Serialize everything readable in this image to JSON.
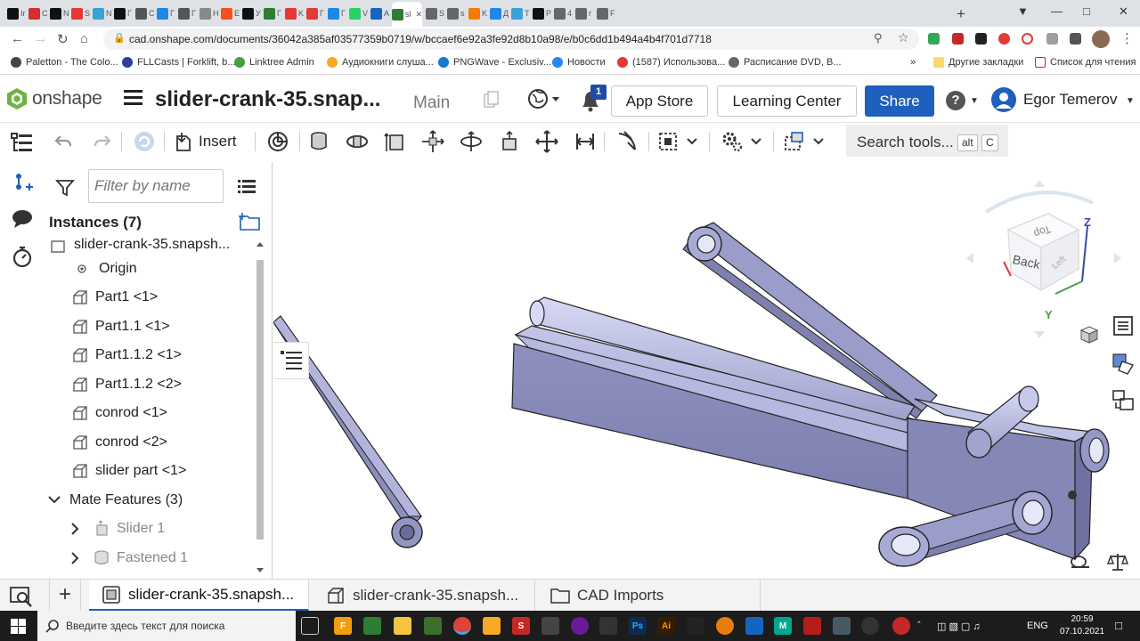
{
  "browser": {
    "tabs": [
      {
        "label": "Ir",
        "color": "#111"
      },
      {
        "label": "C",
        "color": "#d32f2f"
      },
      {
        "label": "N",
        "color": "#111"
      },
      {
        "label": "S",
        "color": "#e53935"
      },
      {
        "label": "N",
        "color": "#3aa0d8"
      },
      {
        "label": "Г",
        "color": "#111"
      },
      {
        "label": "C",
        "color": "#555"
      },
      {
        "label": "Г",
        "color": "#1e88e5"
      },
      {
        "label": "Г",
        "color": "#555"
      },
      {
        "label": "H",
        "color": "#888"
      },
      {
        "label": "E",
        "color": "#f4511e"
      },
      {
        "label": "У",
        "color": "#111"
      },
      {
        "label": "Г",
        "color": "#2e7d32"
      },
      {
        "label": "K",
        "color": "#e53935"
      },
      {
        "label": "Г",
        "color": "#e53935"
      },
      {
        "label": "Г",
        "color": "#1e88e5"
      },
      {
        "label": "V",
        "color": "#25d366"
      },
      {
        "label": "A",
        "color": "#1565c0"
      },
      {
        "label": "sl",
        "color": "#2e7d32"
      },
      {
        "label": "S",
        "color": "#666"
      },
      {
        "label": "s",
        "color": "#666"
      },
      {
        "label": "K",
        "color": "#f57c00"
      },
      {
        "label": "Д",
        "color": "#1e88e5"
      },
      {
        "label": "T",
        "color": "#3aa0d8"
      },
      {
        "label": "P",
        "color": "#111"
      },
      {
        "label": "4",
        "color": "#666"
      },
      {
        "label": "г",
        "color": "#666"
      },
      {
        "label": "F",
        "color": "#666"
      }
    ],
    "url": "cad.onshape.com/documents/36042a385af03577359b0719/w/bccaef6e92a3fe92d8b10a98/e/b0c6dd1b494a4b4f701d7718",
    "bookmarks": [
      {
        "label": "Paletton - The Colo...",
        "color": "#444"
      },
      {
        "label": "FLLCasts | Forklift, b...",
        "color": "#2c3e9e"
      },
      {
        "label": "Linktree Admin",
        "color": "#43a047"
      },
      {
        "label": "Аудиокниги слуша...",
        "color": "#f9a825"
      },
      {
        "label": "PNGWave - Exclusiv...",
        "color": "#1976d2"
      },
      {
        "label": "Новости",
        "color": "#2787f5"
      },
      {
        "label": "(1587) Использова...",
        "color": "#e53935"
      },
      {
        "label": "Расписание DVD, B...",
        "color": "#666"
      }
    ],
    "bookmarks_more": "»",
    "other_bookmarks": "Другие закладки",
    "reading_list": "Список для чтения"
  },
  "header": {
    "logo_text": "onshape",
    "doc_title": "slider-crank-35.snap...",
    "branch": "Main",
    "notification_count": "1",
    "app_store": "App Store",
    "learning_center": "Learning Center",
    "share": "Share",
    "help": "?",
    "user_name": "Egor Temerov",
    "brand_color": "#1f5fbd"
  },
  "toolbar": {
    "insert": "Insert",
    "search_tools": "Search tools...",
    "shortcut_1": "alt",
    "shortcut_2": "C"
  },
  "panel": {
    "filter_placeholder": "Filter by name",
    "instances_title": "Instances (7)",
    "items": [
      {
        "label": "slider-crank-35.snapsh...",
        "icon": "assembly-icon",
        "indent": 0
      },
      {
        "label": "Origin",
        "icon": "origin-icon",
        "indent": 1
      },
      {
        "label": "Part1 <1>",
        "icon": "part-icon",
        "indent": 1
      },
      {
        "label": "Part1.1 <1>",
        "icon": "part-icon",
        "indent": 1
      },
      {
        "label": "Part1.1.2 <1>",
        "icon": "part-icon",
        "indent": 1
      },
      {
        "label": "Part1.1.2 <2>",
        "icon": "part-icon",
        "indent": 1
      },
      {
        "label": "conrod <1>",
        "icon": "part-icon",
        "indent": 1
      },
      {
        "label": "conrod <2>",
        "icon": "part-icon",
        "indent": 1
      },
      {
        "label": "slider part <1>",
        "icon": "part-icon",
        "indent": 1
      }
    ],
    "mate_features_title": "Mate Features (3)",
    "mates": [
      {
        "label": "Slider 1",
        "icon": "slider-mate-icon"
      },
      {
        "label": "Fastened 1",
        "icon": "fastened-mate-icon"
      }
    ]
  },
  "viewcube": {
    "face_top": "Top",
    "face_back": "Back",
    "face_left": "Left",
    "axis_z": "Z",
    "axis_y": "Y"
  },
  "tabs": [
    {
      "label": "slider-crank-35.snapsh...",
      "icon": "assembly-tab-icon",
      "active": true
    },
    {
      "label": "slider-crank-35.snapsh...",
      "icon": "part-studio-tab-icon",
      "active": false
    },
    {
      "label": "CAD Imports",
      "icon": "folder-icon",
      "active": false
    }
  ],
  "taskbar": {
    "search_placeholder": "Введите здесь текст для поиска",
    "language": "ENG",
    "time": "20:59",
    "date": "07.10.2021"
  }
}
